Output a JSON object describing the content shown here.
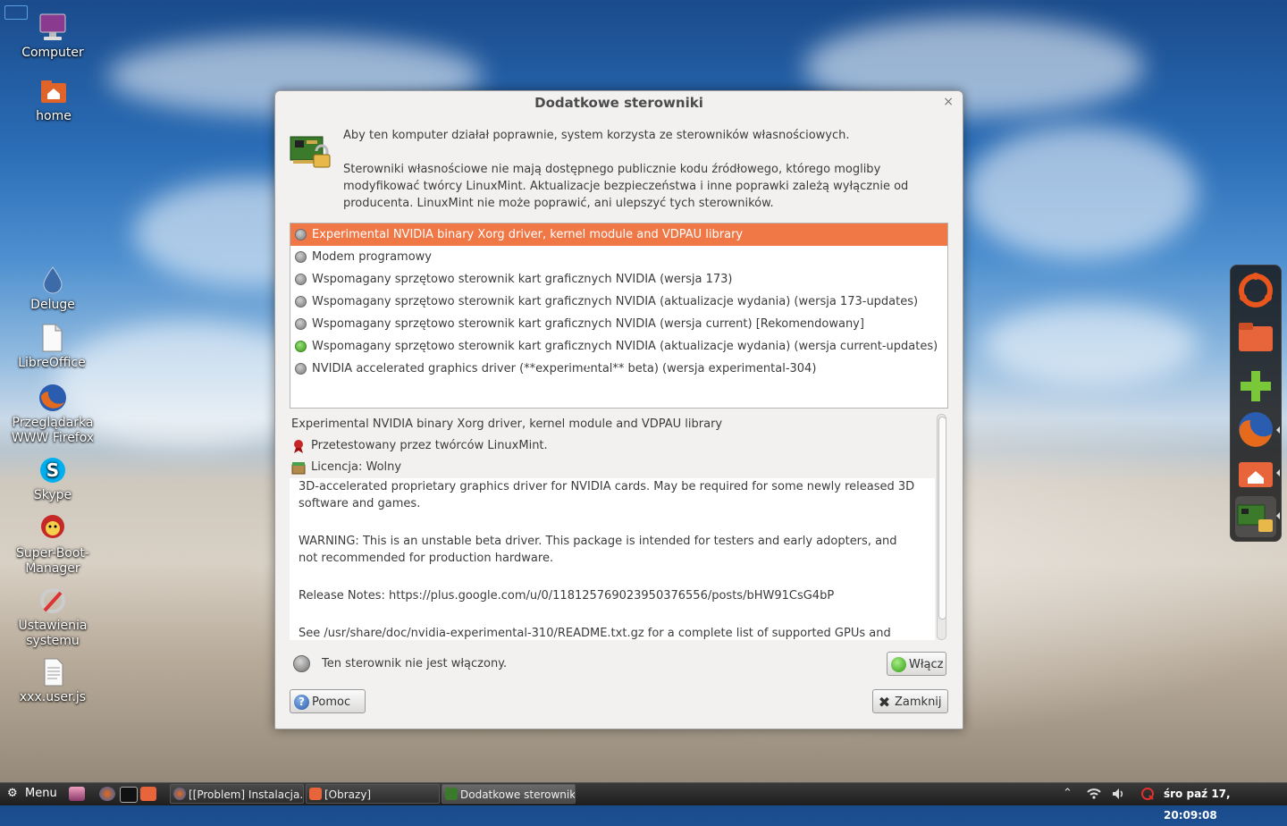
{
  "desktop": {
    "icons": [
      {
        "label": "Computer"
      },
      {
        "label": "home"
      },
      {
        "label": "Deluge"
      },
      {
        "label": "LibreOffice"
      },
      {
        "label": "Przeglądarka WWW Firefox"
      },
      {
        "label": "Skype"
      },
      {
        "label": "Super-Boot-Manager"
      },
      {
        "label": "Ustawienia systemu"
      },
      {
        "label": "xxx.user.js"
      }
    ]
  },
  "dialog": {
    "title": "Dodatkowe sterowniki",
    "close_glyph": "×",
    "intro_p1": "Aby ten komputer działał poprawnie, system korzysta ze sterowników własnościowych.",
    "intro_p2": "Sterowniki własnościowe nie mają dostępnego publicznie kodu źródłowego, którego mogliby modyfikować twórcy LinuxMint. Aktualizacje bezpieczeństwa i inne poprawki zależą wyłącznie od producenta. LinuxMint nie może poprawić, ani ulepszyć tych sterowników.",
    "drivers": [
      {
        "label": "Experimental NVIDIA binary Xorg driver, kernel module and VDPAU library",
        "selected": true,
        "active": false
      },
      {
        "label": "Modem programowy",
        "selected": false,
        "active": false
      },
      {
        "label": "Wspomagany sprzętowo sterownik kart graficznych NVIDIA (wersja 173)",
        "selected": false,
        "active": false
      },
      {
        "label": "Wspomagany sprzętowo sterownik kart graficznych NVIDIA (aktualizacje wydania) (wersja 173-updates)",
        "selected": false,
        "active": false
      },
      {
        "label": "Wspomagany sprzętowo sterownik kart graficznych NVIDIA (wersja current) [Rekomendowany]",
        "selected": false,
        "active": false
      },
      {
        "label": "Wspomagany sprzętowo sterownik kart graficznych NVIDIA (aktualizacje wydania) (wersja current-updates)",
        "selected": false,
        "active": true
      },
      {
        "label": "NVIDIA accelerated graphics driver (**experimental** beta) (wersja experimental-304)",
        "selected": false,
        "active": false
      }
    ],
    "details": {
      "title": "Experimental NVIDIA binary Xorg driver, kernel module and VDPAU library",
      "tested": "Przetestowany przez twórców LinuxMint.",
      "license": "Licencja: Wolny",
      "desc_p1": "3D-accelerated proprietary graphics driver for NVIDIA cards. May be required for some newly released 3D software and games.",
      "desc_p2": "WARNING: This is an unstable beta driver.  This package is intended for testers and early adopters, and not recommended for production hardware.",
      "desc_p3": "Release Notes: https://plus.google.com/u/0/118125769023950376556/posts/bHW91CsG4bP",
      "desc_p4": "See /usr/share/doc/nvidia-experimental-310/README.txt.gz for a complete list of supported GPUs and"
    },
    "status_text": "Ten sterownik nie jest włączony.",
    "enable_label": "Włącz",
    "help_label": "Pomoc",
    "close_label": "Zamknij"
  },
  "taskbar": {
    "menu_label": "Menu",
    "windows": [
      {
        "label": "[[Problem] Instalacja..."
      },
      {
        "label": "[Obrazy]"
      },
      {
        "label": "Dodatkowe sterowniki"
      }
    ],
    "clock": "śro paź 17, 20:09:08"
  },
  "colors": {
    "selection": "#f07746",
    "active_radio": "#3a9a1a"
  }
}
